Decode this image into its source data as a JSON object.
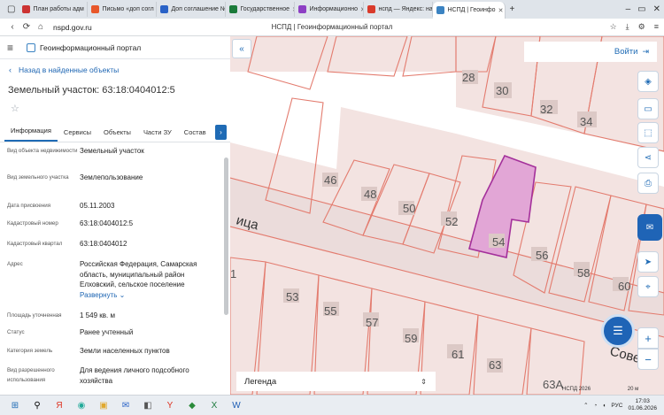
{
  "browser": {
    "tabs": [
      {
        "label": "План работы адм",
        "color": "#c33"
      },
      {
        "label": "Письмо «доп согл",
        "color": "#e8572a"
      },
      {
        "label": "Доп соглашение №",
        "color": "#2a62c7"
      },
      {
        "label": "Государственное",
        "color": "#1a7a3a"
      },
      {
        "label": "Информационно",
        "color": "#8d3fc4"
      },
      {
        "label": "нспд — Яндекс: на",
        "color": "#d93a2b"
      },
      {
        "label": "НСПД | Геоинфо",
        "color": "#3b83c2"
      }
    ],
    "url": "nspd.gov.ru",
    "page_title": "НСПД | Геоинформационный портал"
  },
  "portal": {
    "title": "Геоинформационный портал",
    "back_label": "Назад в найденные объекты",
    "object_title": "Земельный участок: 63:18:0404012:5",
    "tabs": [
      "Информация",
      "Сервисы",
      "Объекты",
      "Части ЗУ",
      "Состав"
    ],
    "attributes": [
      {
        "key": "Вид объекта недвижимости",
        "value": "Земельный участок"
      },
      {
        "key": "Вид земельного участка",
        "value": "Землепользование"
      },
      {
        "key": "Дата присвоения",
        "value": "05.11.2003"
      },
      {
        "key": "Кадастровый номер",
        "value": "63:18:0404012:5"
      },
      {
        "key": "Кадастровый квартал",
        "value": "63:18:0404012"
      },
      {
        "key": "Адрес",
        "value": "Российская Федерация, Самарская область, муниципальный район Елховский, сельское поселение"
      },
      {
        "key": "Площадь уточненная",
        "value": "1 549 кв. м"
      },
      {
        "key": "Статус",
        "value": "Ранее учтенный"
      },
      {
        "key": "Категория земель",
        "value": "Земли населенных пунктов"
      },
      {
        "key": "Вид разрешенного использования",
        "value": "Для ведения личного подсобного хозяйства"
      }
    ],
    "expand_label": "Развернуть"
  },
  "map": {
    "login_label": "Войти",
    "legend_label": "Легенда",
    "street_left": "ица",
    "street_right": "Сове",
    "scale_text": "НСПД 2026",
    "scale_len": "20 м",
    "parcel_numbers": [
      "28",
      "30",
      "32",
      "34",
      "46",
      "48",
      "50",
      "52",
      "54",
      "56",
      "58",
      "60",
      "53",
      "55",
      "57",
      "59",
      "61",
      "63",
      "63А",
      "1"
    ]
  },
  "taskbar": {
    "time": "17:03",
    "date": "01.06.2026",
    "lang": "РУС"
  }
}
